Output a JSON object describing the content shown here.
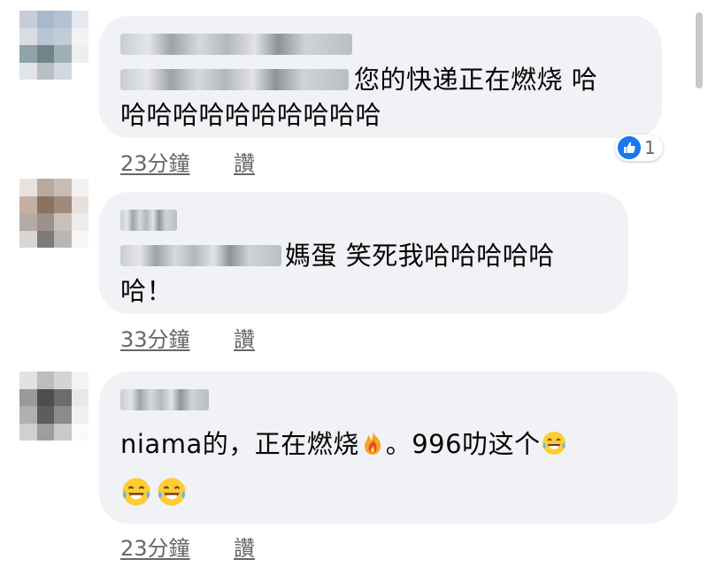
{
  "comments": [
    {
      "text_line1": "您的快递正在燃烧 哈",
      "text_line2": "哈哈哈哈哈哈哈哈哈哈",
      "time": "23分鐘",
      "like_label": "讚",
      "reaction": {
        "icon": "thumbs-up-icon",
        "count": "1"
      }
    },
    {
      "text_line1": "媽蛋 笑死我哈哈哈哈哈",
      "text_line2": "哈！",
      "time": "33分鐘",
      "like_label": "讚"
    },
    {
      "text_prefix": "niama的，正在燃烧",
      "text_middle": "。996叻这个",
      "emoji_inline": [
        "fire-icon",
        "tears-of-joy-icon"
      ],
      "emoji_line2": [
        "tears-of-joy-icon",
        "tears-of-joy-icon"
      ],
      "time": "23分鐘",
      "like_label": "讚"
    }
  ],
  "colors": {
    "bubble": "#f0f2f5",
    "meta": "#65676b",
    "like_blue": "#1877f2",
    "text": "#050505"
  }
}
